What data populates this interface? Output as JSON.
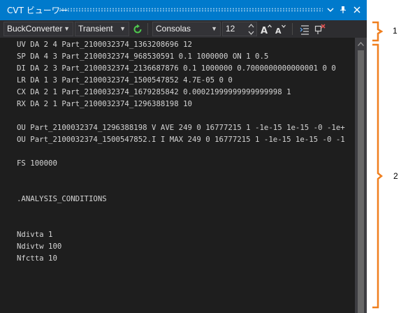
{
  "window": {
    "title": "CVT ビューワー",
    "pin_glyph": "█",
    "close_glyph": "✕"
  },
  "toolbar": {
    "model_value": "BuckConverter",
    "analysis_value": "Transient",
    "font_value": "Consolas",
    "font_size_value": "12"
  },
  "editor": {
    "lines": [
      "UV DA 2 4 Part_2100032374_1363208696 12",
      "SP DA 4 3 Part_2100032374_968530591 0.1 1000000 ON 1 0.5",
      "DI DA 2 3 Part_2100032374_2136687876 0.1 1000000 0.7000000000000001 0 0",
      "LR DA 1 3 Part_2100032374_1500547852 4.7E-05 0 0",
      "CX DA 2 1 Part_2100032374_1679285842 0.00021999999999999998 1",
      "RX DA 2 1 Part_2100032374_1296388198 10",
      "",
      "OU Part_2100032374_1296388198 V AVE 249 0 16777215 1 -1e-15 1e-15 -0 -1e+",
      "OU Part_2100032374_1500547852.I I MAX 249 0 16777215 1 -1e-15 1e-15 -0 -1",
      "",
      "FS 100000",
      "",
      "",
      ".ANALYSIS_CONDITIONS",
      "",
      "",
      "Ndivta 1",
      "Ndivtw 100",
      "Nfctta 10"
    ]
  },
  "annotations": {
    "label_1": "1",
    "label_2": "2"
  },
  "colors": {
    "accent": "#007acc",
    "bracket": "#f07f1e",
    "refresh": "#4ec94e"
  }
}
